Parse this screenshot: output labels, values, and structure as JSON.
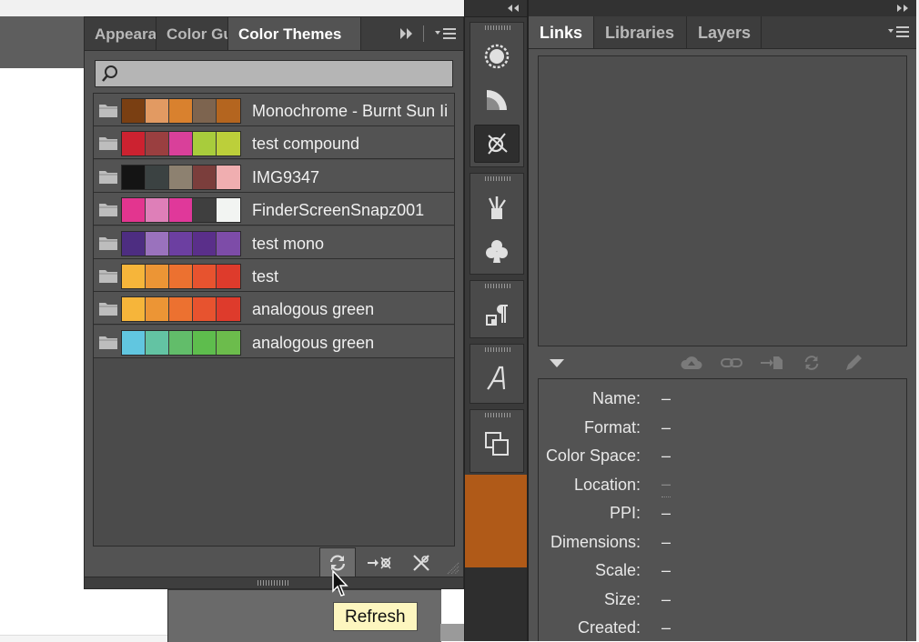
{
  "color_themes_panel": {
    "tabs": [
      {
        "label": "Appearance",
        "active": false
      },
      {
        "label": "Color Guide",
        "active": false
      },
      {
        "label": "Color Themes",
        "active": true
      }
    ],
    "search": {
      "value": "",
      "placeholder": ""
    },
    "themes": [
      {
        "name": "Monochrome - Burnt Sun Ii",
        "colors": [
          "#7a3f12",
          "#e29a62",
          "#d9812e",
          "#7d644f",
          "#b4651f"
        ]
      },
      {
        "name": "test compound",
        "colors": [
          "#cc2230",
          "#9a3f40",
          "#d9409a",
          "#a8cc3c",
          "#bccf3a"
        ]
      },
      {
        "name": "IMG9347",
        "colors": [
          "#141414",
          "#3b4242",
          "#8d8170",
          "#7b3e3c",
          "#f0aeb0"
        ]
      },
      {
        "name": "FinderScreenSnapz001",
        "colors": [
          "#e3358f",
          "#de7fb8",
          "#e0389a",
          "#3f3f3f",
          "#f2f4f2"
        ]
      },
      {
        "name": "test mono",
        "colors": [
          "#4d2d81",
          "#9a72bd",
          "#6c3fa1",
          "#5a2f8a",
          "#7d4ca8"
        ]
      },
      {
        "name": "test",
        "colors": [
          "#f6b53a",
          "#ec9535",
          "#ec7130",
          "#e7532f",
          "#de3b2c"
        ]
      },
      {
        "name": "analogous green",
        "colors": [
          "#f6b53a",
          "#ec9535",
          "#ec7130",
          "#e7532f",
          "#de3b2c"
        ]
      },
      {
        "name": "analogous green",
        "colors": [
          "#61c6e0",
          "#63c3a3",
          "#62bd6a",
          "#5ebd4d",
          "#6cbc4c"
        ]
      }
    ],
    "tools": [
      {
        "icon": "refresh-icon"
      },
      {
        "icon": "add-to-swatches-icon"
      },
      {
        "icon": "delete-icon"
      }
    ],
    "tooltip": "Refresh"
  },
  "links_panel": {
    "tabs": [
      {
        "label": "Links",
        "active": true
      },
      {
        "label": "Libraries",
        "active": false
      },
      {
        "label": "Layers",
        "active": false
      }
    ],
    "info": [
      {
        "label": "Name:",
        "value": "–"
      },
      {
        "label": "Format:",
        "value": "–"
      },
      {
        "label": "Color Space:",
        "value": "–"
      },
      {
        "label": "Location:",
        "value": "–"
      },
      {
        "label": "PPI:",
        "value": "–"
      },
      {
        "label": "Dimensions:",
        "value": "–"
      },
      {
        "label": "Scale:",
        "value": "–"
      },
      {
        "label": "Size:",
        "value": "–"
      },
      {
        "label": "Created:",
        "value": "–"
      }
    ]
  }
}
